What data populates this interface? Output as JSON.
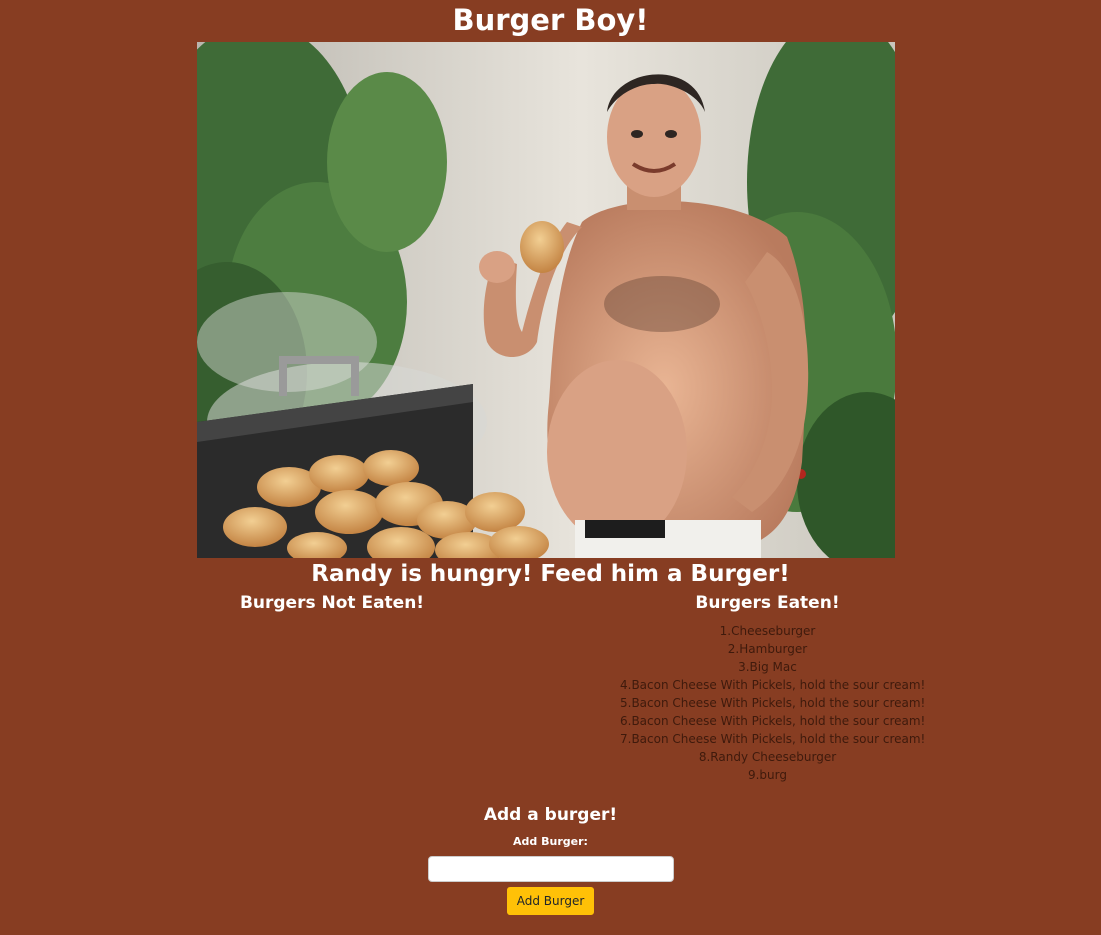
{
  "header": {
    "title": "Burger Boy!"
  },
  "subtitle": "Randy is hungry! Feed him a Burger!",
  "not_eaten": {
    "heading": "Burgers Not Eaten!",
    "items": []
  },
  "eaten": {
    "heading": "Burgers Eaten!",
    "items": [
      "1.Cheeseburger",
      "2.Hamburger",
      "3.Big Mac",
      "4.Bacon Cheese With Pickels, hold the sour cream!",
      "5.Bacon Cheese With Pickels, hold the sour cream!",
      "6.Bacon Cheese With Pickels, hold the sour cream!",
      "7.Bacon Cheese With Pickels, hold the sour cream!",
      "8.Randy Cheeseburger",
      "9.burg"
    ]
  },
  "add_form": {
    "heading": "Add a burger!",
    "label": "Add Burger:",
    "input_value": "",
    "input_placeholder": "",
    "button_label": "Add Burger"
  },
  "colors": {
    "background": "#873d22",
    "button": "#ffc107",
    "eaten_text": "#3f1a0c"
  }
}
